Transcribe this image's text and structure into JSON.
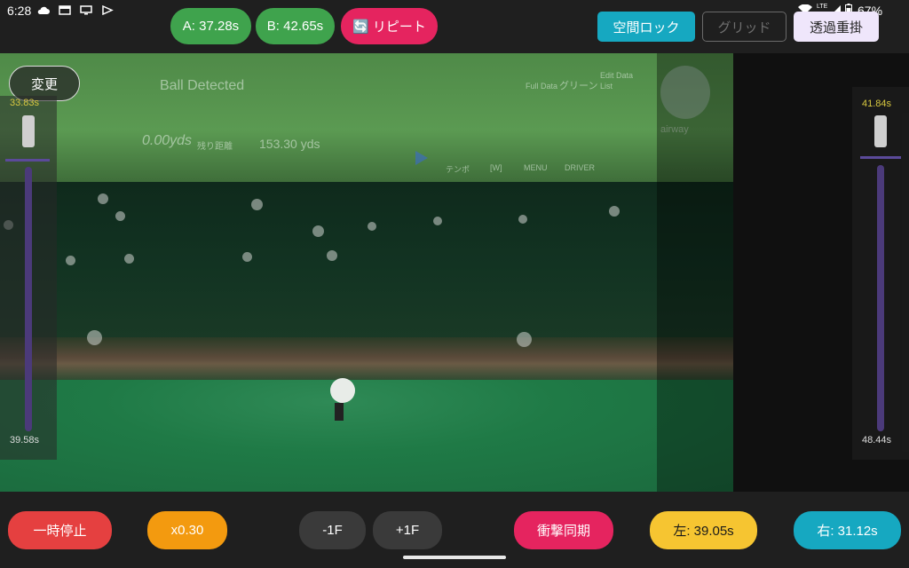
{
  "status_bar": {
    "time": "6:28",
    "network": "LTE",
    "battery": "67%"
  },
  "top": {
    "point_a": "A: 37.28s",
    "point_b": "B: 42.65s",
    "repeat": "🔄 リピート",
    "space_lock": "空間ロック",
    "grid": "グリッド",
    "overlay": "透過重掛"
  },
  "video": {
    "change_label": "変更",
    "hud": {
      "ball_detected": "Ball Detected",
      "distance": "0.00yds",
      "distance_label": "残り距離",
      "remaining": "153.30 yds",
      "menu_tempo": "テンポ",
      "menu_w": "[W]",
      "menu_menu": "MENU",
      "menu_driver": "DRIVER",
      "full_data": "Full Data",
      "green": "グリーン",
      "edit_data": "Edit Data",
      "list": "List",
      "fairway": "airway"
    }
  },
  "left_slider": {
    "top_value": "33.83s",
    "bottom_value": "39.58s",
    "position": 0.14
  },
  "right_slider": {
    "top_value": "41.84s",
    "bottom_value": "48.44s",
    "position": 0.12
  },
  "bottom": {
    "pause": "一時停止",
    "speed": "x0.30",
    "prev_frame": "-1F",
    "next_frame": "+1F",
    "impact_sync": "衝撃同期",
    "left_time": "左: 39.05s",
    "right_time": "右: 31.12s"
  },
  "colors": {
    "green_pill": "#3fa34d",
    "pink": "#e5245f",
    "teal": "#16a8c1",
    "orange": "#f39a0f",
    "yellow": "#f6c531",
    "red": "#e54040",
    "dark_btn": "#3a3a3a",
    "lavender": "#efe6fb"
  }
}
